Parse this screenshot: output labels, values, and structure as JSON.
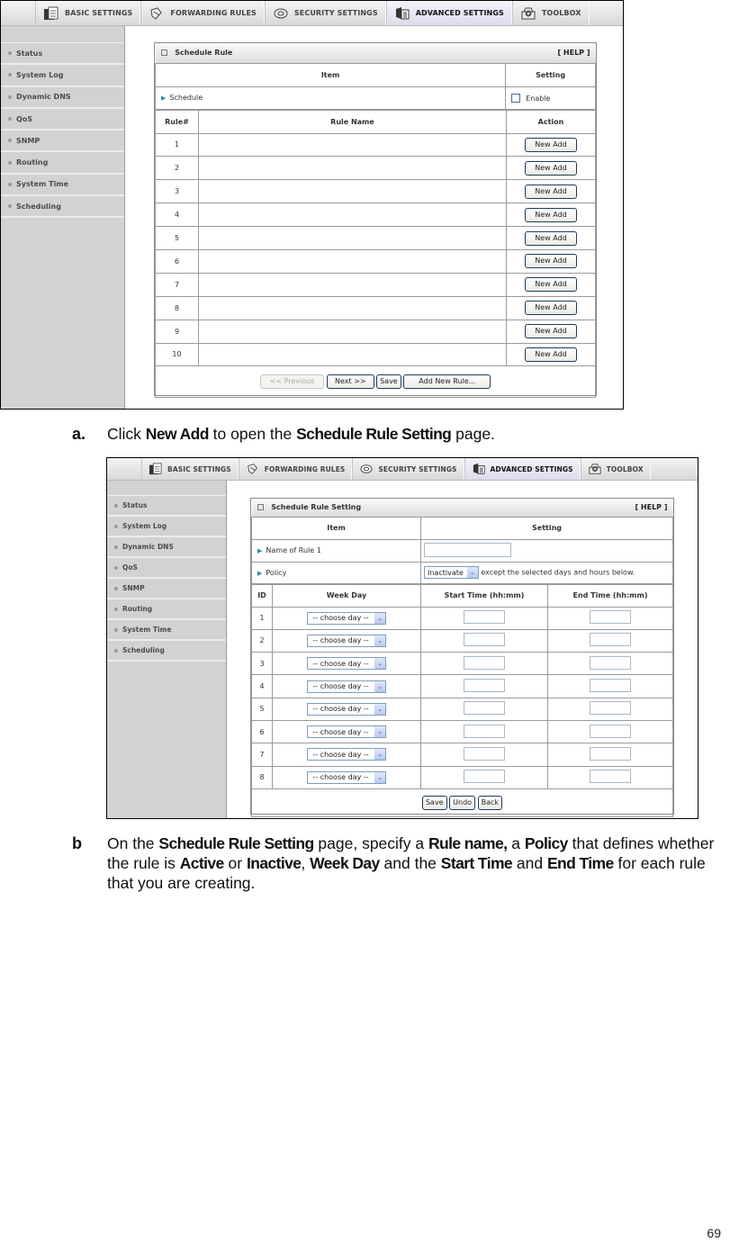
{
  "nav_tabs": [
    {
      "label": "BASIC SETTINGS",
      "icon": "folder-document-icon",
      "active": false
    },
    {
      "label": "FORWARDING RULES",
      "icon": "forwarding-arrows-icon",
      "active": false
    },
    {
      "label": "SECURITY SETTINGS",
      "icon": "lock-nut-icon",
      "active": false
    },
    {
      "label": "ADVANCED SETTINGS",
      "icon": "advanced-panel-icon",
      "active": true
    },
    {
      "label": "TOOLBOX",
      "icon": "toolbox-gear-icon",
      "active": false
    }
  ],
  "sidebar": {
    "items": [
      {
        "label": "Status"
      },
      {
        "label": "System Log"
      },
      {
        "label": "Dynamic DNS"
      },
      {
        "label": "QoS"
      },
      {
        "label": "SNMP"
      },
      {
        "label": "Routing"
      },
      {
        "label": "System Time"
      },
      {
        "label": "Scheduling"
      }
    ]
  },
  "schedule_rule": {
    "title": "Schedule Rule",
    "help": "[ HELP ]",
    "item_header": "Item",
    "setting_header": "Setting",
    "schedule_label": "Schedule",
    "enable_label": "Enable",
    "enable_checked": false,
    "col_rule_num": "Rule#",
    "col_rule_name": "Rule Name",
    "col_action": "Action",
    "rows": [
      {
        "num": "1",
        "name": "",
        "action": "New Add"
      },
      {
        "num": "2",
        "name": "",
        "action": "New Add"
      },
      {
        "num": "3",
        "name": "",
        "action": "New Add"
      },
      {
        "num": "4",
        "name": "",
        "action": "New Add"
      },
      {
        "num": "5",
        "name": "",
        "action": "New Add"
      },
      {
        "num": "6",
        "name": "",
        "action": "New Add"
      },
      {
        "num": "7",
        "name": "",
        "action": "New Add"
      },
      {
        "num": "8",
        "name": "",
        "action": "New Add"
      },
      {
        "num": "9",
        "name": "",
        "action": "New Add"
      },
      {
        "num": "10",
        "name": "",
        "action": "New Add"
      }
    ],
    "buttons": {
      "previous": "<< Previous",
      "next": "Next >>",
      "save": "Save",
      "add_new_rule": "Add New Rule..."
    }
  },
  "step_a": {
    "marker": "a.",
    "t1": "Click ",
    "b1": "New Add",
    "t2": " to open the ",
    "b2": "Schedule Rule Setting",
    "t3": " page."
  },
  "schedule_rule_setting": {
    "title": "Schedule Rule Setting",
    "help": "[ HELP ]",
    "item_header": "Item",
    "setting_header": "Setting",
    "name_label": "Name of Rule 1",
    "name_value": "",
    "policy_label": "Policy",
    "policy_value": "Inactivate",
    "policy_suffix": "except the selected days and hours below.",
    "col_id": "ID",
    "col_week_day": "Week Day",
    "col_start": "Start Time (hh:mm)",
    "col_end": "End Time (hh:mm)",
    "rows": [
      {
        "id": "1",
        "day": "-- choose day --",
        "start": "",
        "end": ""
      },
      {
        "id": "2",
        "day": "-- choose day --",
        "start": "",
        "end": ""
      },
      {
        "id": "3",
        "day": "-- choose day --",
        "start": "",
        "end": ""
      },
      {
        "id": "4",
        "day": "-- choose day --",
        "start": "",
        "end": ""
      },
      {
        "id": "5",
        "day": "-- choose day --",
        "start": "",
        "end": ""
      },
      {
        "id": "6",
        "day": "-- choose day --",
        "start": "",
        "end": ""
      },
      {
        "id": "7",
        "day": "-- choose day --",
        "start": "",
        "end": ""
      },
      {
        "id": "8",
        "day": "-- choose day --",
        "start": "",
        "end": ""
      }
    ],
    "buttons": {
      "save": "Save",
      "undo": "Undo",
      "back": "Back"
    }
  },
  "step_b": {
    "marker": "b",
    "t1": "On the ",
    "b1": "Schedule Rule Setting",
    "t2": " page, specify a ",
    "b2": "Rule name,",
    "t3": " a ",
    "b3": "Policy",
    "t4": " that defines whether the rule is ",
    "b4": "Active",
    "t5": " or ",
    "b5": "Inactive",
    "t6": ", ",
    "b6": "Week Day",
    "t7": " and the ",
    "b7": "Start Time",
    "t8": " and ",
    "b8": "End Time",
    "t9": " for each rule that you are creating."
  },
  "page_number": "69"
}
